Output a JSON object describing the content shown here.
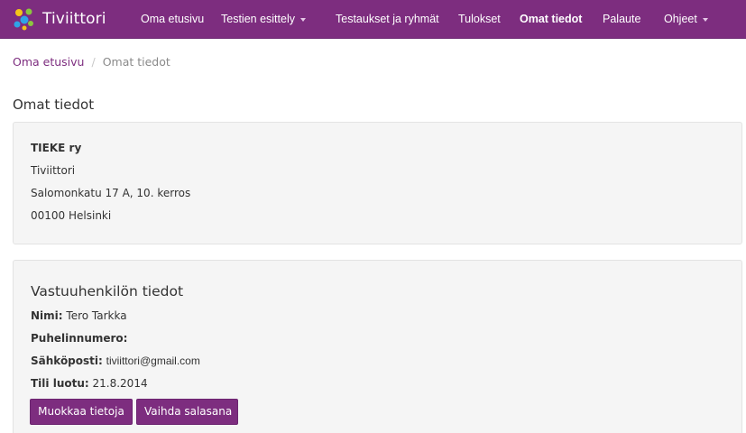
{
  "navbar": {
    "brand": "Tiviittori",
    "items": [
      {
        "label": "Oma etusivu",
        "active": false,
        "dropdown": false
      },
      {
        "label": "Testien esittely",
        "active": false,
        "dropdown": true
      },
      {
        "label": "Testaukset ja ryhmät",
        "active": false,
        "dropdown": false
      },
      {
        "label": "Tulokset",
        "active": false,
        "dropdown": false
      },
      {
        "label": "Omat tiedot",
        "active": true,
        "dropdown": false
      },
      {
        "label": "Palaute",
        "active": false,
        "dropdown": false
      },
      {
        "label": "Ohjeet",
        "active": false,
        "dropdown": true
      }
    ]
  },
  "breadcrumb": {
    "home": "Oma etusivu",
    "separator": "/",
    "current": "Omat tiedot"
  },
  "page_title": "Omat tiedot",
  "organization": {
    "name": "TIEKE ry",
    "unit": "Tiviittori",
    "street": "Salomonkatu 17 A, 10. kerros",
    "postal": "00100 Helsinki"
  },
  "contact": {
    "title": "Vastuuhenkilön tiedot",
    "name_label": "Nimi:",
    "name_value": "Tero Tarkka",
    "phone_label": "Puhelinnumero:",
    "email_label": "Sähköposti:",
    "email_value": "tiviittori@gmail.com",
    "created_label": "Tili luotu:",
    "created_value": "21.8.2014"
  },
  "buttons": {
    "edit": "Muokkaa tietoja",
    "password": "Vaihda salasana"
  },
  "colors": {
    "brand": "#7d2d7f",
    "well_bg": "#f5f5f5",
    "text": "#333333"
  }
}
